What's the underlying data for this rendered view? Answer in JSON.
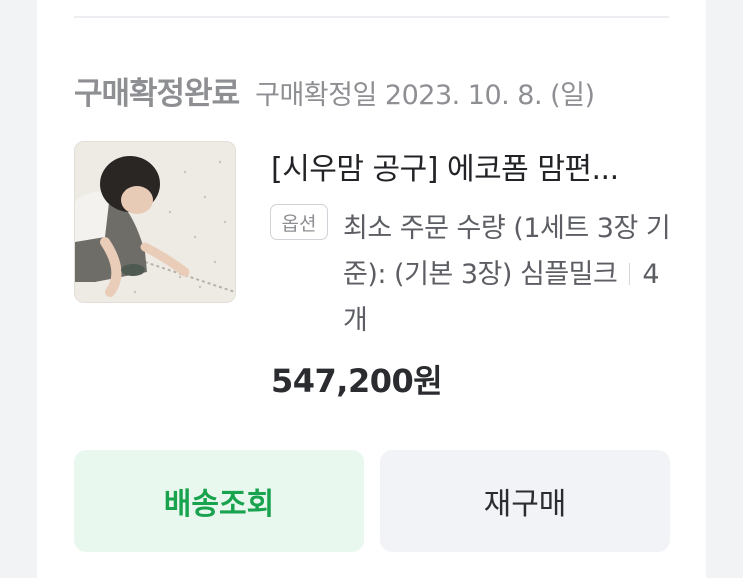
{
  "order": {
    "status": "구매확정완료",
    "confirm_date": "구매확정일 2023. 10. 8. (일)"
  },
  "product": {
    "title": "[시우맘 공구] 에코폼 맘편...",
    "option_badge": "옵션",
    "option_text": "최소 주문 수량 (1세트 3장 기준): (기본 3장) 심플밀크",
    "quantity": "4개",
    "price": "547,200원",
    "image_icon": "product-photo-child-on-mat"
  },
  "actions": {
    "track_label": "배송조회",
    "rebuy_label": "재구매"
  },
  "colors": {
    "accent_green": "#1aa34f",
    "track_bg": "#e9f8ef",
    "muted_text": "#8e8f93"
  }
}
